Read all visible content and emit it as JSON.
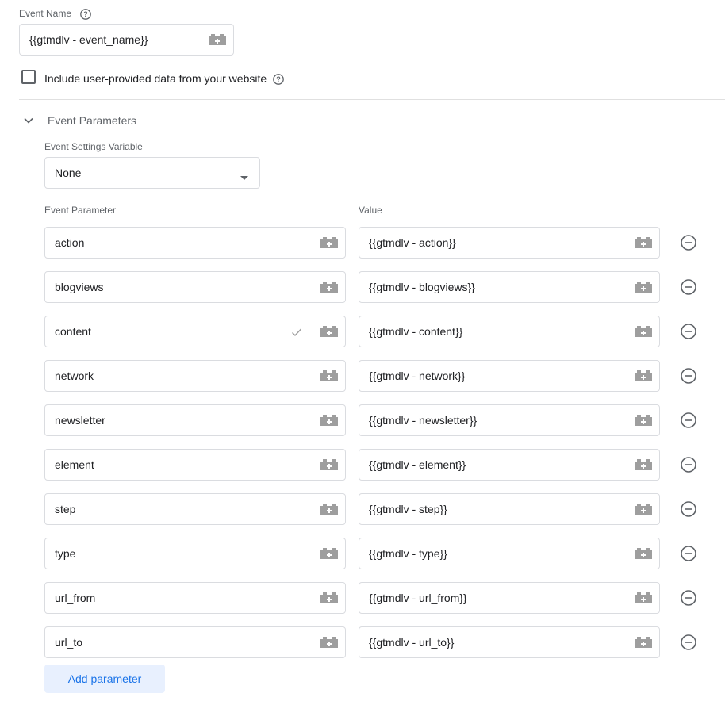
{
  "event_name": {
    "label": "Event Name",
    "value": "{{gtmdlv - event_name}}",
    "help_icon": "help-circle-icon",
    "variable_icon": "lego-brick-icon"
  },
  "user_data": {
    "checked": false,
    "label": "Include user-provided data from your website",
    "help_icon": "help-circle-icon"
  },
  "event_parameters": {
    "section_title": "Event Parameters",
    "expand_icon": "chevron-down-icon",
    "settings_variable_label": "Event Settings Variable",
    "settings_variable_value": "None",
    "col_parameter": "Event Parameter",
    "col_value": "Value",
    "rows": [
      {
        "name": "action",
        "value": "{{gtmdlv - action}}",
        "validated": false
      },
      {
        "name": "blogviews",
        "value": "{{gtmdlv - blogviews}}",
        "validated": false
      },
      {
        "name": "content",
        "value": "{{gtmdlv - content}}",
        "validated": true
      },
      {
        "name": "network",
        "value": "{{gtmdlv - network}}",
        "validated": false
      },
      {
        "name": "newsletter",
        "value": "{{gtmdlv - newsletter}}",
        "validated": false
      },
      {
        "name": "element",
        "value": "{{gtmdlv - element}}",
        "validated": false
      },
      {
        "name": "step",
        "value": "{{gtmdlv - step}}",
        "validated": false
      },
      {
        "name": "type",
        "value": "{{gtmdlv - type}}",
        "validated": false
      },
      {
        "name": "url_from",
        "value": "{{gtmdlv - url_from}}",
        "validated": false
      },
      {
        "name": "url_to",
        "value": "{{gtmdlv - url_to}}",
        "validated": false
      }
    ],
    "add_button": "Add parameter"
  },
  "colors": {
    "accent": "#1a73e8",
    "add_button_bg": "#e8f0fe",
    "border": "#dadce0",
    "muted_text": "#5f6368",
    "icon_gray": "#9e9e9e"
  }
}
